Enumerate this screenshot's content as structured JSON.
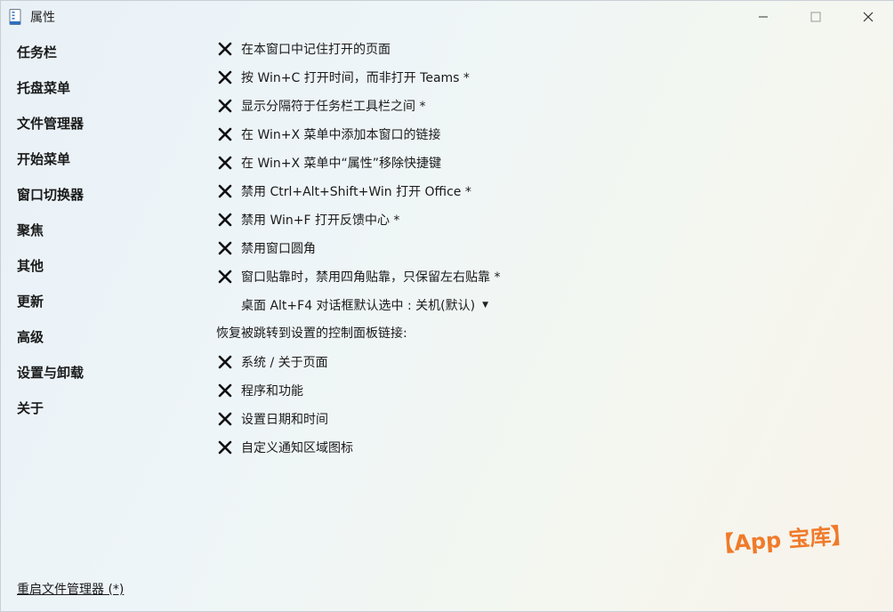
{
  "window": {
    "title": "属性",
    "icon": "properties-icon"
  },
  "sidebar": {
    "items": [
      {
        "label": "任务栏"
      },
      {
        "label": "托盘菜单"
      },
      {
        "label": "文件管理器"
      },
      {
        "label": "开始菜单"
      },
      {
        "label": "窗口切换器"
      },
      {
        "label": "聚焦"
      },
      {
        "label": "其他"
      },
      {
        "label": "更新"
      },
      {
        "label": "高级"
      },
      {
        "label": "设置与卸载"
      },
      {
        "label": "关于"
      }
    ],
    "restart_link": "重启文件管理器 (*)"
  },
  "options": [
    {
      "label": "在本窗口中记住打开的页面",
      "checked": true
    },
    {
      "label": "按 Win+C 打开时间，而非打开 Teams *",
      "checked": true
    },
    {
      "label": "显示分隔符于任务栏工具栏之间 *",
      "checked": true
    },
    {
      "label": "在 Win+X 菜单中添加本窗口的链接",
      "checked": true
    },
    {
      "label": "在 Win+X 菜单中“属性”移除快捷键",
      "checked": true
    },
    {
      "label": "禁用 Ctrl+Alt+Shift+Win 打开 Office *",
      "checked": true
    },
    {
      "label": "禁用 Win+F 打开反馈中心 *",
      "checked": true
    },
    {
      "label": "禁用窗口圆角",
      "checked": true
    },
    {
      "label": "窗口贴靠时，禁用四角贴靠，只保留左右贴靠 *",
      "checked": true
    }
  ],
  "dropdown": {
    "label": "桌面 Alt+F4 对话框默认选中 : 关机(默认)",
    "icon": "caret-down-icon"
  },
  "section_heading": "恢复被跳转到设置的控制面板链接:",
  "section_options": [
    {
      "label": "系统 / 关于页面",
      "checked": true
    },
    {
      "label": "程序和功能",
      "checked": true
    },
    {
      "label": "设置日期和时间",
      "checked": true
    },
    {
      "label": "自定义通知区域图标",
      "checked": true
    }
  ],
  "watermark": "【App 宝库】",
  "colors": {
    "watermark": "#f07a2a",
    "text": "#1a1a1a"
  }
}
